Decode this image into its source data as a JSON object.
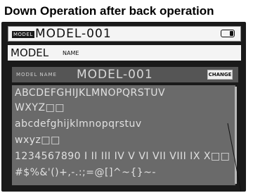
{
  "caption": "Down Operation after back operation",
  "header": {
    "model_tag": "MODEL",
    "model_name": "MODEL-001",
    "battery_level": 0.3
  },
  "model_name_row": {
    "title": "MODEL",
    "subtitle": "NAME"
  },
  "editor": {
    "label": "MODEL NAME",
    "value": "MODEL-001",
    "change_label": "CHANGE"
  },
  "char_lines": [
    "ABCDEFGHIJKLMNOPQRSTUV",
    "WXYZ□□",
    "abcdefghijklmnopqrstuv",
    "wxyz□□",
    "1234567890 I II III IV V VI VII VIII IX X□□",
    "#$%&'()+,-.:;=@[]^~{}~-"
  ],
  "colors": {
    "lcd_background": "#1a1a1a",
    "panel_gray": "#555555",
    "grid_gray": "#6a6a6a",
    "light_text": "#e0e0e0",
    "bar_background": "#f4f4f4"
  }
}
